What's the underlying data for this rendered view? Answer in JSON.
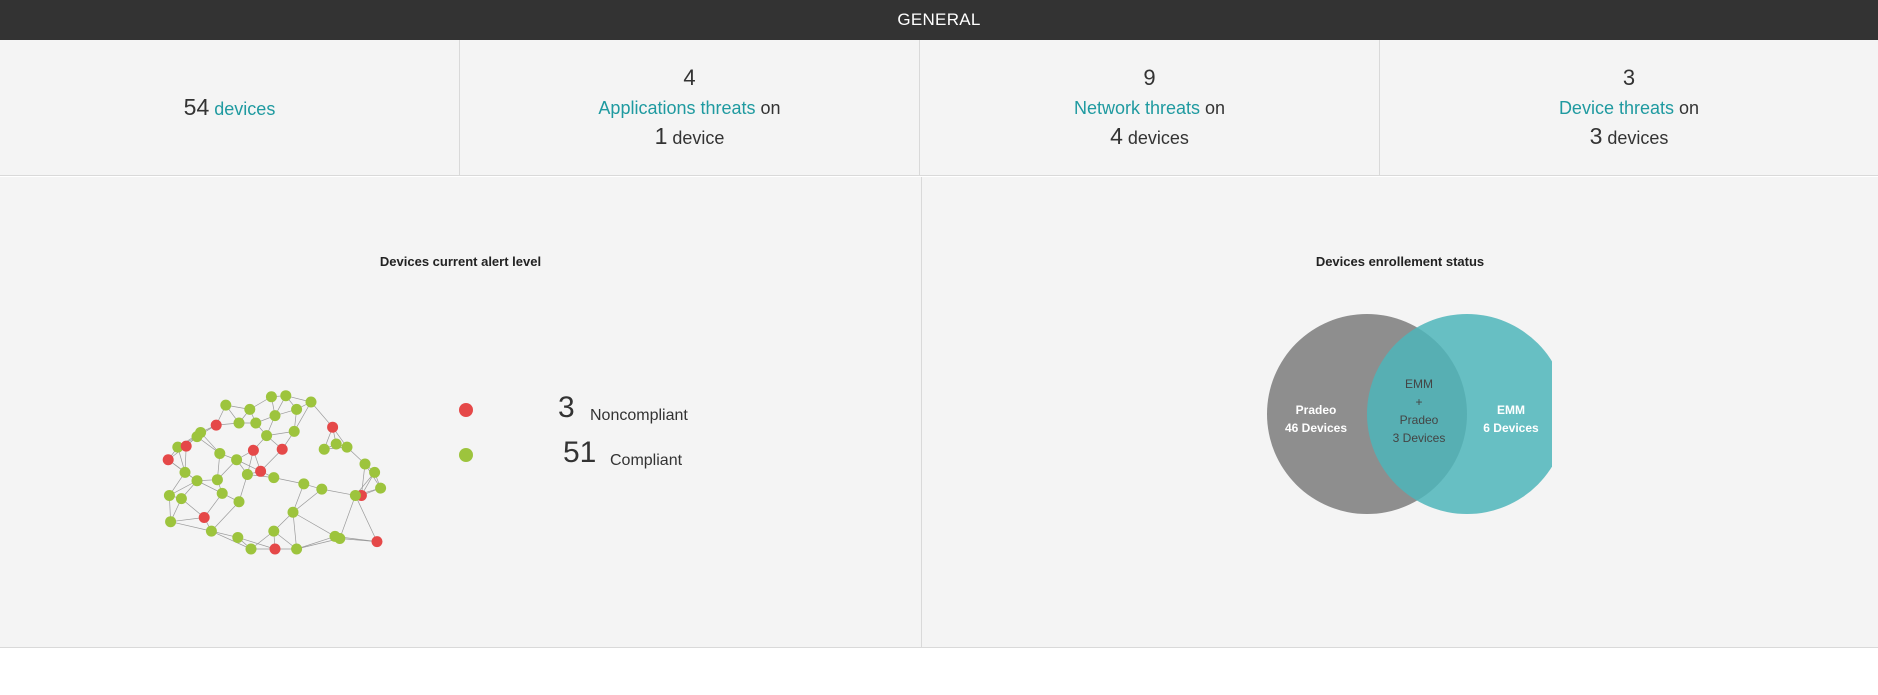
{
  "header": {
    "title": "GENERAL"
  },
  "stats": {
    "devices": {
      "count": "54",
      "label": "devices"
    },
    "applications": {
      "count": "4",
      "link": "Applications threats",
      "on": "on",
      "device_count": "1",
      "device_label": "device"
    },
    "network": {
      "count": "9",
      "link": "Network threats",
      "on": "on",
      "device_count": "4",
      "device_label": "devices"
    },
    "device": {
      "count": "3",
      "link": "Device threats",
      "on": "on",
      "device_count": "3",
      "device_label": "devices"
    }
  },
  "alert_panel": {
    "title": "Devices current alert level",
    "legend": [
      {
        "count": "3",
        "label": "Noncompliant",
        "color": "#e54848"
      },
      {
        "count": "51",
        "label": "Compliant",
        "color": "#9dc43d"
      }
    ]
  },
  "enrollment_panel": {
    "title": "Devices enrollement status",
    "left": {
      "name": "Pradeo",
      "value": "46 Devices",
      "color": "#7b7b7b"
    },
    "right": {
      "name": "EMM",
      "value": "6 Devices",
      "color": "#4db5ba"
    },
    "overlap": {
      "line1": "EMM",
      "line2": "+",
      "line3": "Pradeo",
      "value": "3 Devices"
    }
  }
}
